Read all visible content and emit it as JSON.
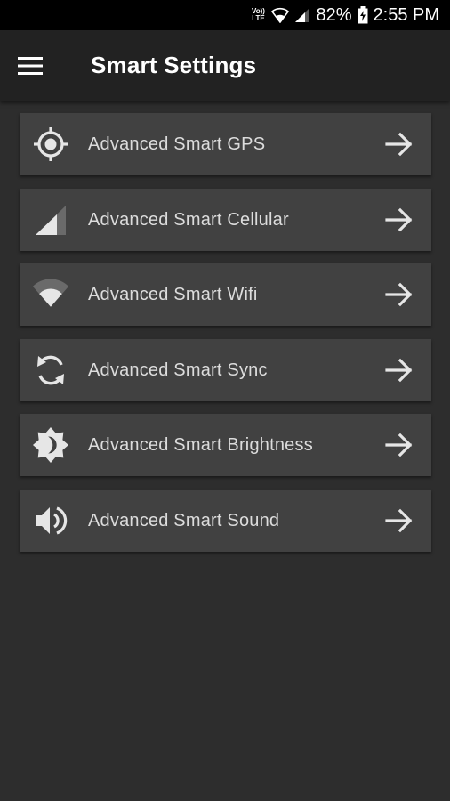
{
  "status_bar": {
    "volte": "Vo)) LTE",
    "battery": "82%",
    "time": "2:55 PM"
  },
  "app_bar": {
    "title": "Smart Settings",
    "menu_icon": "hamburger-menu-icon"
  },
  "items": [
    {
      "label": "Advanced Smart GPS",
      "icon": "gps-icon"
    },
    {
      "label": "Advanced Smart Cellular",
      "icon": "cellular-signal-icon"
    },
    {
      "label": "Advanced Smart Wifi",
      "icon": "wifi-icon"
    },
    {
      "label": "Advanced Smart Sync",
      "icon": "sync-icon"
    },
    {
      "label": "Advanced Smart Brightness",
      "icon": "brightness-icon"
    },
    {
      "label": "Advanced Smart Sound",
      "icon": "volume-icon"
    }
  ],
  "colors": {
    "background": "#2d2d2d",
    "app_bar": "#222222",
    "card": "#414141",
    "text": "#dcdcdc",
    "icon": "#e6e6e6"
  }
}
